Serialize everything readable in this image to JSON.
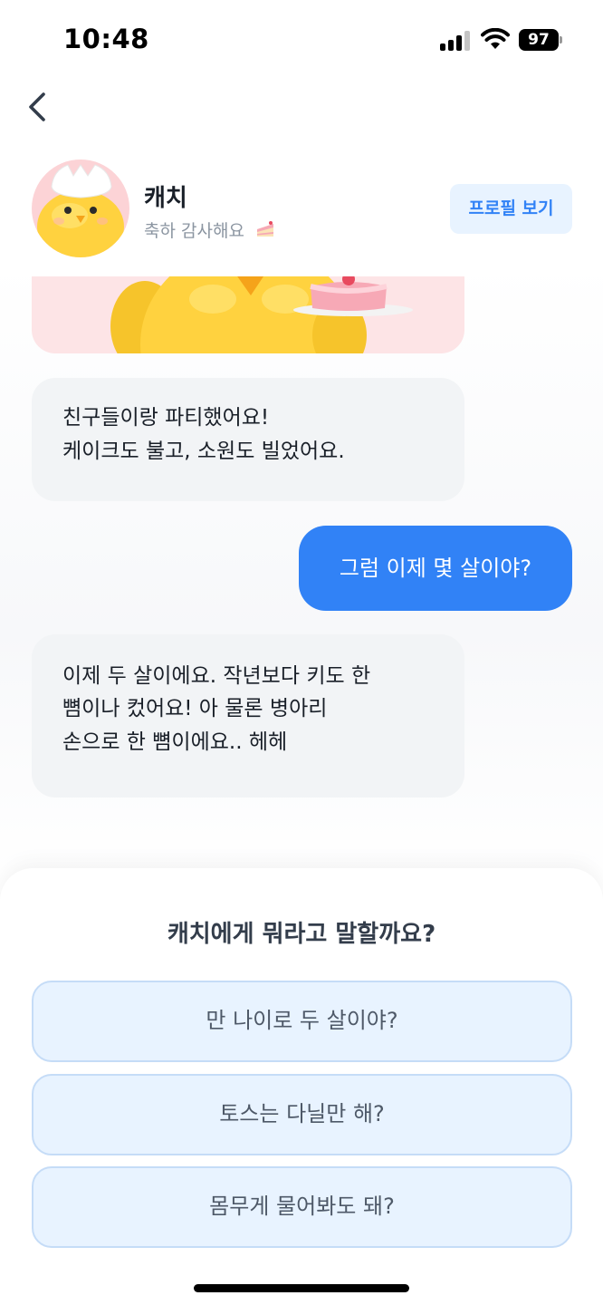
{
  "status_bar": {
    "time": "10:48",
    "battery": "97",
    "icons": [
      "signal-icon",
      "wifi-icon",
      "battery-icon"
    ]
  },
  "nav": {
    "back_icon": "chevron-left-icon"
  },
  "header": {
    "name": "캐치",
    "status": "축하 감사해요",
    "status_emoji": "cake-icon",
    "profile_button": "프로필 보기"
  },
  "messages": [
    {
      "from": "bot",
      "lines": [
        "친구들이랑 파티했어요!",
        "케이크도 불고, 소원도 빌었어요."
      ]
    },
    {
      "from": "me",
      "text": "그럼 이제 몇 살이야?"
    },
    {
      "from": "bot",
      "lines": [
        "이제 두 살이에요. 작년보다 키도 한",
        "뼘이나 컸어요! 아 물론 병아리",
        "손으로 한 뼘이에요.. 헤헤"
      ]
    }
  ],
  "reply_sheet": {
    "title": "캐치에게 뭐라고 말할까요?",
    "options": [
      "만 나이로 두 살이야?",
      "토스는 다닐만 해?",
      "몸무게 물어봐도 돼?"
    ]
  },
  "colors": {
    "accent": "#3182f6",
    "received_bubble": "#f2f4f6",
    "option_bg": "#e8f3ff",
    "avatar_bg": "#fcd3d6"
  }
}
